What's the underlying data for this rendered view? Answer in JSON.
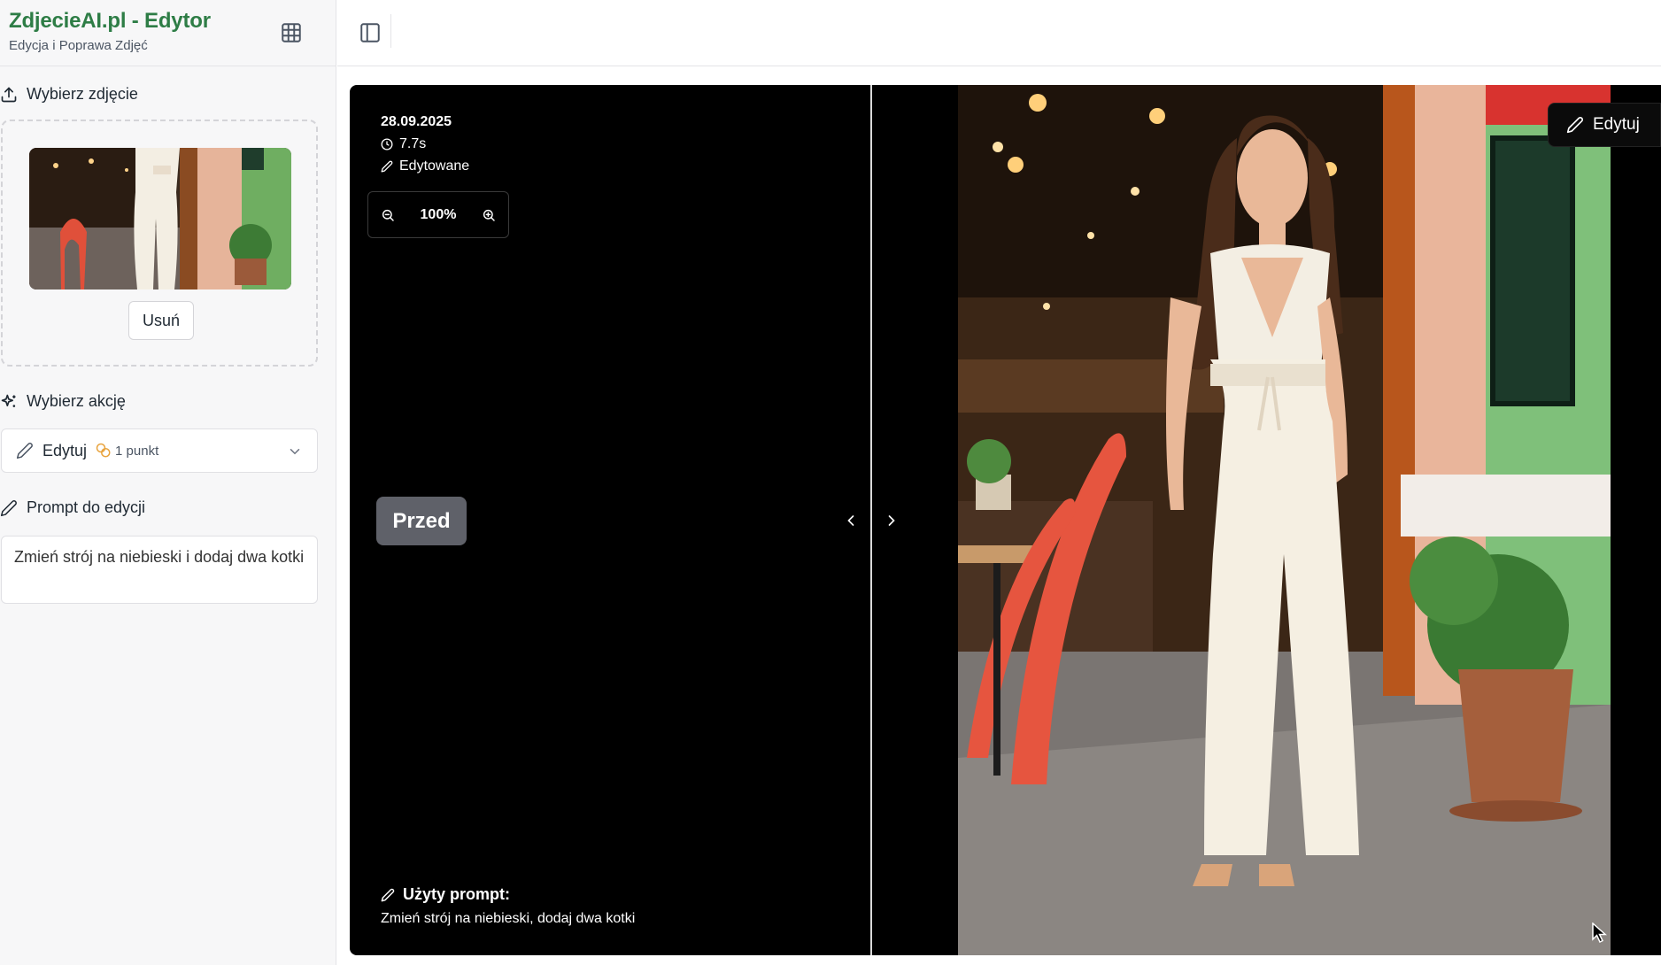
{
  "sidebar": {
    "app_title": "ZdjecieAI.pl - Edytor",
    "app_subtitle": "Edycja i Poprawa Zdjęć",
    "upload_section_label": "Wybierz zdjęcie",
    "remove_button_label": "Usuń",
    "action_section_label": "Wybierz akcję",
    "action_select": {
      "value": "Edytuj",
      "points": "1 punkt"
    },
    "prompt_section_label": "Prompt do edycji",
    "prompt_value": "Zmień strój na niebieski i dodaj dwa kotki"
  },
  "viewer": {
    "date": "28.09.2025",
    "duration": "7.7s",
    "status": "Edytowane",
    "zoom_level": "100%",
    "before_label": "Przed",
    "edit_button_label": "Edytuj",
    "used_prompt_label": "Użyty prompt:",
    "used_prompt_text": "Zmień strój na niebieski, dodaj dwa kotki"
  },
  "icons": {
    "grid": "grid-icon",
    "sidebar_toggle": "sidebar-toggle-icon",
    "upload": "upload-icon",
    "sparkles": "sparkles-icon",
    "pencil": "pencil-icon",
    "coins": "coins-icon",
    "chevron_down": "chevron-down-icon",
    "clock": "clock-icon",
    "zoom_out": "zoom-out-icon",
    "zoom_in": "zoom-in-icon",
    "chevron_left": "chevron-left-icon",
    "chevron_right": "chevron-right-icon"
  },
  "colors": {
    "brand_green": "#2e7d46",
    "coin_orange": "#e8a33d",
    "viewer_bg": "#000000",
    "badge_gray": "#5f6169"
  }
}
